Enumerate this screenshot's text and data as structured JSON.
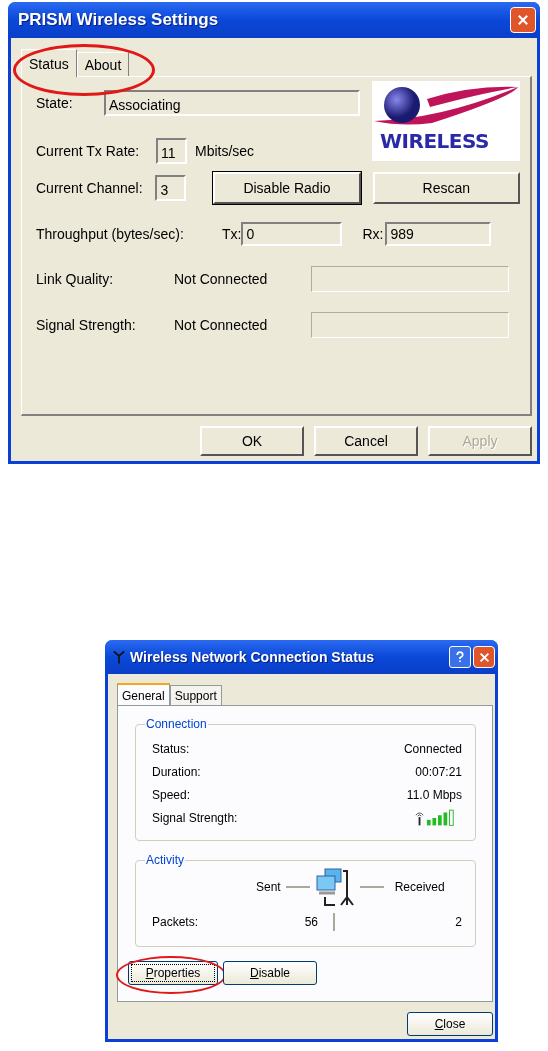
{
  "prism_window": {
    "title": "PRISM Wireless Settings",
    "tabs": [
      {
        "label": "Status",
        "selected": true
      },
      {
        "label": "About",
        "selected": false
      }
    ],
    "tabs_circled": true,
    "logo_text": "WIRELESS",
    "state": {
      "label": "State:",
      "value": "Associating"
    },
    "tx_rate": {
      "label": "Current Tx Rate:",
      "value": "11",
      "unit": "Mbits/sec"
    },
    "channel": {
      "label": "Current Channel:",
      "value": "3"
    },
    "radio_buttons": [
      {
        "label": "Disable Radio",
        "default": true
      },
      {
        "label": "Rescan",
        "default": false
      }
    ],
    "throughput": {
      "label": "Throughput (bytes/sec):",
      "tx_label": "Tx:",
      "tx_value": "0",
      "rx_label": "Rx:",
      "rx_value": "989"
    },
    "meters": [
      {
        "label": "Link Quality:",
        "value": "Not Connected"
      },
      {
        "label": "Signal Strength:",
        "value": "Not Connected"
      }
    ],
    "buttons": [
      {
        "label": "OK",
        "disabled": false
      },
      {
        "label": "Cancel",
        "disabled": false
      },
      {
        "label": "Apply",
        "disabled": true
      }
    ]
  },
  "status_window": {
    "title": "Wireless Network Connection Status",
    "tabs": [
      {
        "label": "General",
        "selected": true
      },
      {
        "label": "Support",
        "selected": false
      }
    ],
    "connection": {
      "title": "Connection",
      "rows": [
        {
          "label": "Status:",
          "value": "Connected"
        },
        {
          "label": "Duration:",
          "value": "00:07:21"
        },
        {
          "label": "Speed:",
          "value": "11.0 Mbps"
        },
        {
          "label": "Signal Strength:",
          "kind": "signal"
        }
      ]
    },
    "activity": {
      "title": "Activity",
      "sent": "Sent",
      "received": "Received",
      "packets_label": "Packets:",
      "packets_sent": "56",
      "packets_received": "2"
    },
    "buttons": [
      {
        "label": "Properties",
        "circled": true
      },
      {
        "label": "Disable"
      }
    ],
    "close": "Close"
  }
}
